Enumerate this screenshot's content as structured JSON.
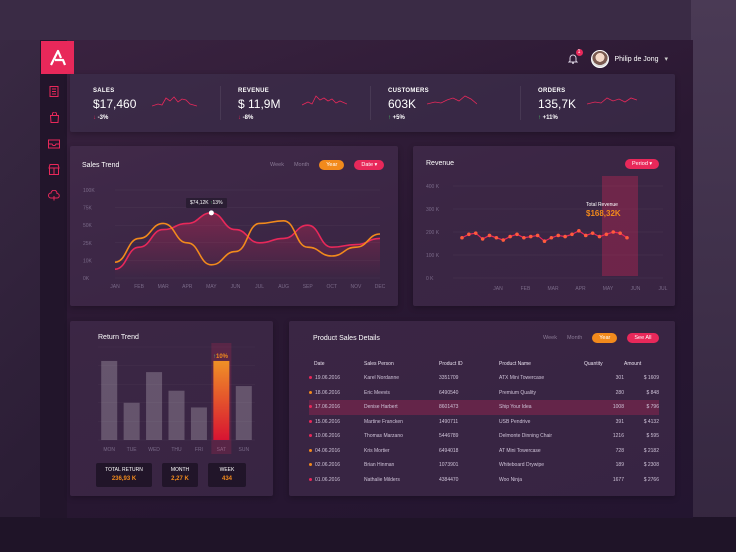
{
  "header": {
    "logo_text": "A",
    "notifications_count": "1",
    "user_name": "Philip de Jong",
    "chevron": "⌄"
  },
  "sidebar_icons": [
    "document-icon",
    "bag-icon",
    "inbox-icon",
    "store-icon",
    "cloud-icon"
  ],
  "kpis": [
    {
      "label": "SALES",
      "value": "$17,460",
      "change": "-3%",
      "direction": "down"
    },
    {
      "label": "REVENUE",
      "value": "$ 11,9M",
      "change": "-8%",
      "direction": "down"
    },
    {
      "label": "CUSTOMERS",
      "value": "603K",
      "change": "+5%",
      "direction": "up"
    },
    {
      "label": "ORDERS",
      "value": "135,7K",
      "change": "+11%",
      "direction": "up"
    }
  ],
  "sales_trend": {
    "title": "Sales Trend",
    "tabs": [
      "Week",
      "Month",
      "Year"
    ],
    "active_tab": "Year",
    "dropdown": "Date",
    "tooltip_value": "$74,12K",
    "tooltip_change": "13%"
  },
  "revenue": {
    "title": "Revenue",
    "dropdown": "Period",
    "highlight_label": "Total Revenue",
    "highlight_value": "$168,32K"
  },
  "return_trend": {
    "title": "Return Trend",
    "bar_change": "10%",
    "boxes": [
      {
        "label": "TOTAL RETURN",
        "value": "236,93 K"
      },
      {
        "label": "MONTH",
        "value": "2,27 K"
      },
      {
        "label": "WEEK",
        "value": "434"
      }
    ]
  },
  "product_sales": {
    "title": "Product Sales Details",
    "tabs": [
      "Week",
      "Month",
      "Year"
    ],
    "active_tab": "Year",
    "see_all": "See All",
    "columns": [
      "Date",
      "Sales Person",
      "Product ID",
      "Product Name",
      "Quantity",
      "Amount"
    ],
    "rows": [
      {
        "date": "19.06.2016",
        "person": "Karel Nordanne",
        "id": "3351709",
        "name": "ATX Mini Towercase",
        "qty": "301",
        "amount": "$ 1609",
        "dot": "#e8285a"
      },
      {
        "date": "18.06.2016",
        "person": "Eric Meevis",
        "id": "6490540",
        "name": "Premium Quality",
        "qty": "280",
        "amount": "$ 848",
        "dot": "#f28a1c"
      },
      {
        "date": "17.06.2016",
        "person": "Denise Harbert",
        "id": "8601473",
        "name": "Ship Your Idea",
        "qty": "1008",
        "amount": "$ 796",
        "dot": "#e8285a"
      },
      {
        "date": "15.06.2016",
        "person": "Martine Francken",
        "id": "1490711",
        "name": "USB Pendrive",
        "qty": "391",
        "amount": "$ 4132",
        "dot": "#e8285a"
      },
      {
        "date": "10.06.2016",
        "person": "Thomas Marzano",
        "id": "5446789",
        "name": "Delmonte Dinning Chair",
        "qty": "1216",
        "amount": "$ 595",
        "dot": "#e8285a"
      },
      {
        "date": "04.06.2016",
        "person": "Kris Mortier",
        "id": "6494018",
        "name": "AT Mini Towercase",
        "qty": "728",
        "amount": "$ 2182",
        "dot": "#f28a1c"
      },
      {
        "date": "02.06.2016",
        "person": "Brian Hinman",
        "id": "1073901",
        "name": "Whiteboard Drywipe",
        "qty": "189",
        "amount": "$ 2308",
        "dot": "#f28a1c"
      },
      {
        "date": "01.06.2016",
        "person": "Nathalie Milders",
        "id": "4384470",
        "name": "Woo Ninja",
        "qty": "1677",
        "amount": "$ 2766",
        "dot": "#e8285a"
      }
    ]
  },
  "chart_data": [
    {
      "type": "line",
      "title": "Sales Trend",
      "categories": [
        "JAN",
        "FEB",
        "MAR",
        "APR",
        "MAY",
        "JUN",
        "JUL",
        "AUG",
        "SEP",
        "OCT",
        "NOV",
        "DEC"
      ],
      "y_ticks": [
        "100K",
        "75K",
        "50K",
        "25K",
        "10K",
        "0K"
      ],
      "series": [
        {
          "values": [
            10,
            35,
            55,
            62,
            74,
            55,
            40,
            45,
            60,
            35,
            38,
            45
          ],
          "color": "#e8285a"
        },
        {
          "values": [
            18,
            45,
            62,
            40,
            15,
            30,
            62,
            65,
            35,
            25,
            35,
            50
          ],
          "color": "#f28a1c"
        }
      ]
    },
    {
      "type": "line",
      "title": "Revenue",
      "categories": [
        "JAN",
        "FEB",
        "MAR",
        "APR",
        "MAY",
        "JUN",
        "JUL"
      ],
      "y_ticks": [
        "400 K",
        "300 K",
        "200 K",
        "100 K",
        "0 K"
      ],
      "x": [
        0,
        0.25,
        0.5,
        0.75,
        1,
        1.25,
        1.5,
        1.75,
        2,
        2.25,
        2.5,
        2.75,
        3,
        3.25,
        3.5,
        3.75,
        4,
        4.25,
        4.5,
        4.75,
        5,
        5.25,
        5.5,
        5.75,
        6
      ],
      "values": [
        175,
        190,
        195,
        170,
        185,
        175,
        165,
        180,
        190,
        175,
        180,
        185,
        160,
        175,
        185,
        180,
        190,
        205,
        185,
        195,
        180,
        190,
        200,
        195,
        175
      ],
      "color": "#e8285a",
      "highlight_category": "MAY"
    },
    {
      "type": "bar",
      "title": "Return Trend",
      "categories": [
        "MON",
        "TUE",
        "WED",
        "THU",
        "FRI",
        "SAT",
        "SUN"
      ],
      "values": [
        85,
        40,
        73,
        53,
        35,
        85,
        58
      ],
      "highlight_category": "SAT"
    }
  ]
}
